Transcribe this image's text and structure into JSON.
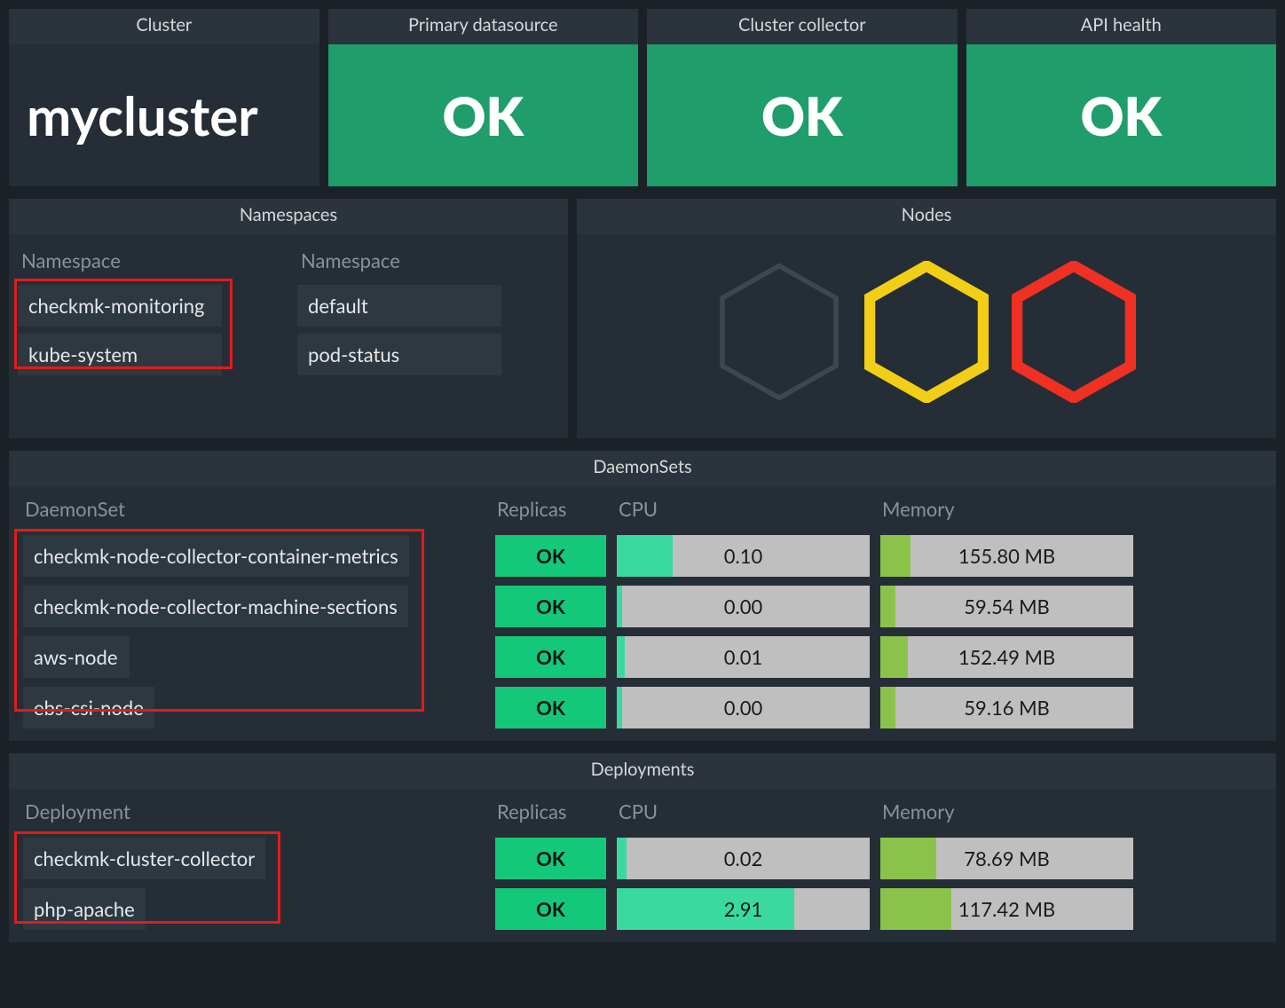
{
  "top": {
    "cluster_header": "Cluster",
    "cluster_name": "mycluster",
    "primary_header": "Primary datasource",
    "primary_status": "OK",
    "collector_header": "Cluster collector",
    "collector_status": "OK",
    "api_header": "API health",
    "api_status": "OK"
  },
  "namespaces": {
    "header": "Namespaces",
    "col1_header": "Namespace",
    "col2_header": "Namespace",
    "col1": [
      "checkmk-monitoring",
      "kube-system"
    ],
    "col2": [
      "default",
      "pod-status"
    ]
  },
  "nodes": {
    "header": "Nodes"
  },
  "daemonsets": {
    "header": "DaemonSets",
    "col_name": "DaemonSet",
    "col_replicas": "Replicas",
    "col_cpu": "CPU",
    "col_memory": "Memory",
    "rows": [
      {
        "name": "checkmk-node-collector-container-metrics",
        "replicas": "OK",
        "cpu": "0.10",
        "cpu_pct": 22,
        "mem": "155.80 MB",
        "mem_pct": 12
      },
      {
        "name": "checkmk-node-collector-machine-sections",
        "replicas": "OK",
        "cpu": "0.00",
        "cpu_pct": 2,
        "mem": "59.54 MB",
        "mem_pct": 6
      },
      {
        "name": "aws-node",
        "replicas": "OK",
        "cpu": "0.01",
        "cpu_pct": 3,
        "mem": "152.49 MB",
        "mem_pct": 11
      },
      {
        "name": "ebs-csi-node",
        "replicas": "OK",
        "cpu": "0.00",
        "cpu_pct": 2,
        "mem": "59.16 MB",
        "mem_pct": 6
      }
    ]
  },
  "deployments": {
    "header": "Deployments",
    "col_name": "Deployment",
    "col_replicas": "Replicas",
    "col_cpu": "CPU",
    "col_memory": "Memory",
    "rows": [
      {
        "name": "checkmk-cluster-collector",
        "replicas": "OK",
        "cpu": "0.02",
        "cpu_pct": 4,
        "mem": "78.69 MB",
        "mem_pct": 22
      },
      {
        "name": "php-apache",
        "replicas": "OK",
        "cpu": "2.91",
        "cpu_pct": 70,
        "mem": "117.42 MB",
        "mem_pct": 28
      }
    ]
  }
}
